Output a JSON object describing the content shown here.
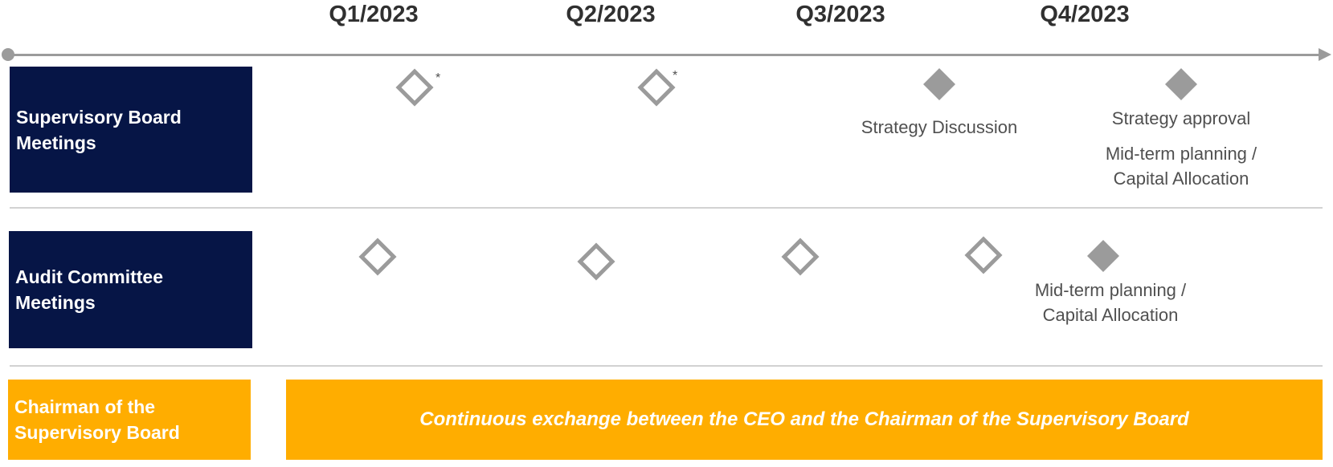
{
  "quarters": [
    "Q1/2023",
    "Q2/2023",
    "Q3/2023",
    "Q4/2023"
  ],
  "rows": {
    "supervisory": {
      "label_line1": "Supervisory Board",
      "label_line2": "Meetings"
    },
    "audit": {
      "label_line1": "Audit Committee",
      "label_line2": "Meetings"
    },
    "chairman": {
      "label_line1": "Chairman of the",
      "label_line2": "Supervisory Board"
    }
  },
  "markers": {
    "footnote_symbol": "*",
    "legend_note": "hollow diamond = regular meeting, filled diamond = meeting with key topic"
  },
  "annotations": {
    "strategy_discussion": "Strategy Discussion",
    "strategy_approval": "Strategy approval",
    "sb_midterm_line1": "Mid-term planning /",
    "sb_midterm_line2": "Capital Allocation",
    "ac_midterm_line1": "Mid-term planning /",
    "ac_midterm_line2": "Capital Allocation"
  },
  "banner": {
    "text": "Continuous exchange between the CEO and the Chairman of the Supervisory Board"
  },
  "colors": {
    "navy": "#061546",
    "gold": "#ffad00",
    "marker_gray": "#9b9b9b",
    "text_gray": "#505050"
  }
}
